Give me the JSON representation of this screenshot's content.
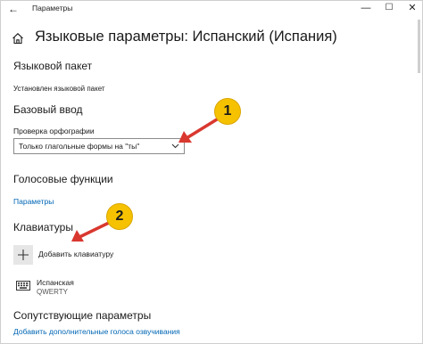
{
  "window": {
    "back_icon": "←",
    "title": "Параметры",
    "minimize": "—",
    "maximize": "☐",
    "close": "✕"
  },
  "header": {
    "home_icon": "home-icon",
    "title": "Языковые параметры: Испанский (Испания)"
  },
  "language_pack": {
    "heading": "Языковой пакет",
    "status": "Установлен языковой пакет"
  },
  "basic_input": {
    "heading": "Базовый ввод",
    "spellcheck_label": "Проверка орфографии",
    "spellcheck_value": "Только глагольные формы на \"ты\""
  },
  "speech": {
    "heading": "Голосовые функции",
    "link": "Параметры"
  },
  "keyboards": {
    "heading": "Клавиатуры",
    "add_label": "Добавить клавиатуру",
    "items": [
      {
        "name": "Испанская",
        "layout": "QWERTY"
      }
    ]
  },
  "related": {
    "heading": "Сопутствующие параметры",
    "link": "Добавить дополнительные голоса озвучивания"
  },
  "callouts": [
    {
      "number": "1"
    },
    {
      "number": "2"
    }
  ],
  "colors": {
    "accent": "#0066b4",
    "callout": "#f6c200",
    "arrow": "#d9382f"
  }
}
